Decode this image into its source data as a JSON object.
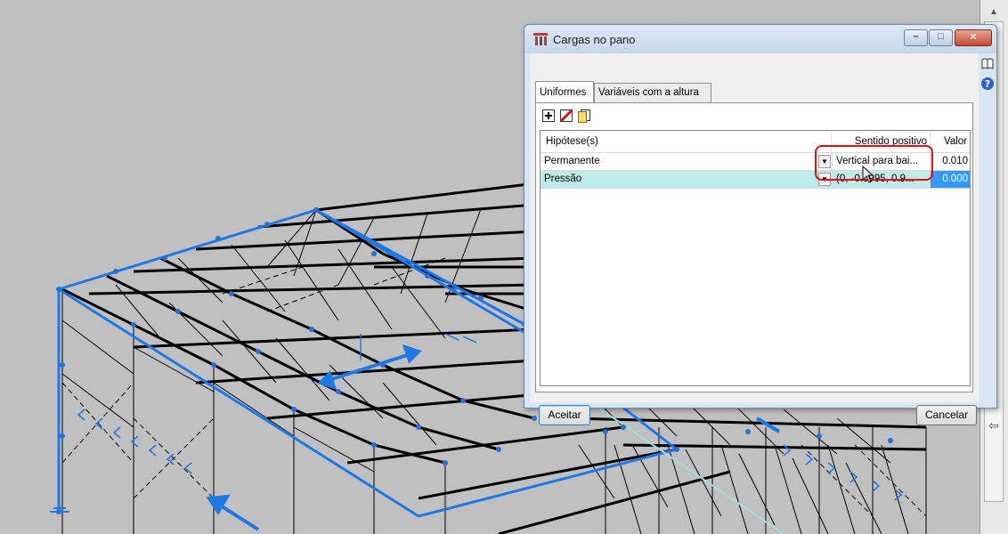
{
  "dialog": {
    "title": "Cargas no pano",
    "icon": "cypecad-cargas-icon",
    "window_buttons": {
      "minimize": "–",
      "maximize": "□",
      "close": "✕"
    },
    "side_icons": [
      "book-help-icon",
      "question-help-icon"
    ]
  },
  "tabs": [
    {
      "label": "Uniformes",
      "active": true
    },
    {
      "label": "Variáveis com a altura",
      "active": false
    }
  ],
  "toolbar": {
    "icons": [
      "add-row-icon",
      "delete-row-icon",
      "copy-row-icon"
    ]
  },
  "grid": {
    "columns": [
      "Hipótese(s)",
      "Sentido positivo",
      "Valor"
    ],
    "rows": [
      {
        "hypothesis": "Permanente",
        "direction": "Vertical para bai...",
        "value": "0.010",
        "selected": false
      },
      {
        "hypothesis": "Pressão",
        "direction": "(0, -0.0995, 0.9...",
        "value": "0.000",
        "selected": true
      }
    ]
  },
  "buttons": {
    "ok": "Aceitar",
    "cancel": "Cancelar"
  },
  "colors": {
    "structure": "#000000",
    "selection_blue": "#1e78e6",
    "node": "#2a6fd6",
    "highlight": "#e01010",
    "row_selected": "#bfeaea",
    "value_selected": "#3399ff"
  }
}
